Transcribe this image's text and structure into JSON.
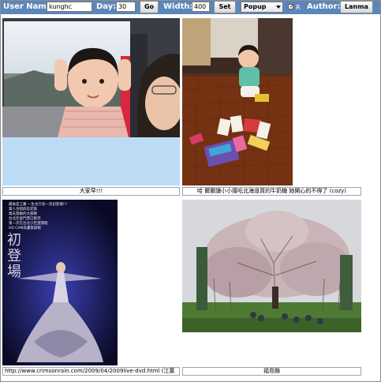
{
  "toolbar": {
    "user_name_label": "User Name:",
    "user_name_value": "kunghc",
    "day_label": "Day:",
    "day_value": "30",
    "go_label": "Go",
    "width_label": "Width:",
    "width_value": "400",
    "set_label": "Set",
    "popup_value": "Popup",
    "r_checkbox_label": "R",
    "r_checked": true,
    "author_label": "Author:",
    "author_button": "Lanma"
  },
  "photos": [
    {
      "caption": "大家早!!!",
      "icon": "photo-baby-train"
    },
    {
      "caption": "哈 爾爾讀小小撞吃北海道買的牛奶糖 她開心的不得了 (cozy)",
      "icon": "photo-toddler-floor"
    },
    {
      "caption": "http://www.crimsonrain.com/2009/04/2009live-dvd.html (江蕙",
      "icon": "photo-concert-poster"
    },
    {
      "caption": "福島縣",
      "icon": "photo-cherry-tree"
    }
  ],
  "poster_text": {
    "title": "初登場",
    "line1": "最後是江蕙 一生也只有一次初登場!!!",
    "line2": "萬人合唱四首老歌",
    "line3": "萬夫莫敵的大部隊",
    "line4": "台北巨蛋門票已售完",
    "line5": "第一次在台北小巨蛋開唱",
    "line6": "HD CAM高畫質錄製"
  },
  "colors": {
    "toolbar_bg": "#5b86b9",
    "cell_bg": "#bcdcf6"
  }
}
